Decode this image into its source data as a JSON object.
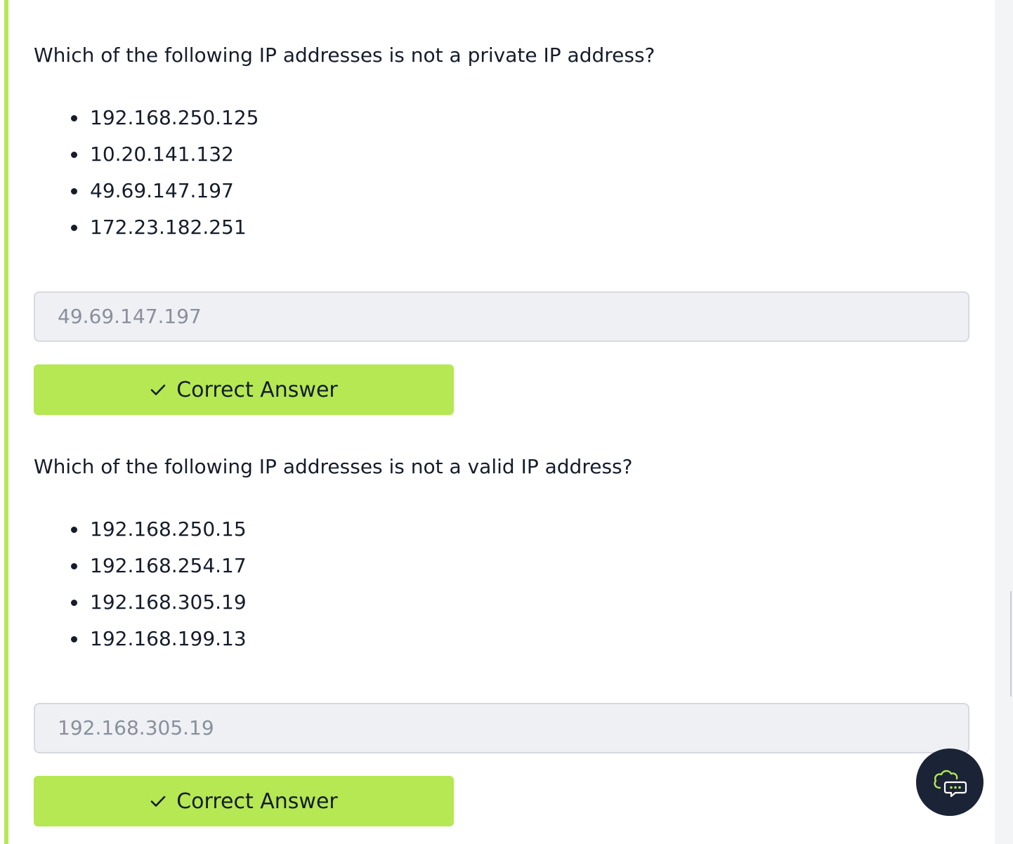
{
  "colors": {
    "accent": "#b5e853",
    "text": "#151c2b",
    "input_bg": "#eef0f4",
    "input_text": "#8a8f9c",
    "fab_bg": "#1b2336"
  },
  "tasks": [
    {
      "question": "Which of the following IP addresses is not a private IP address?",
      "options": [
        "192.168.250.125",
        "10.20.141.132",
        "49.69.147.197",
        "172.23.182.251"
      ],
      "answer": "49.69.147.197",
      "button_label": "Correct Answer",
      "button_icon": "check-icon"
    },
    {
      "question": "Which of the following IP addresses is not a valid IP address?",
      "options": [
        "192.168.250.15",
        "192.168.254.17",
        "192.168.305.19",
        "192.168.199.13"
      ],
      "answer": "192.168.305.19",
      "button_label": "Correct Answer",
      "button_icon": "check-icon"
    }
  ],
  "chat_button": {
    "icon": "cloud-chat-icon"
  }
}
